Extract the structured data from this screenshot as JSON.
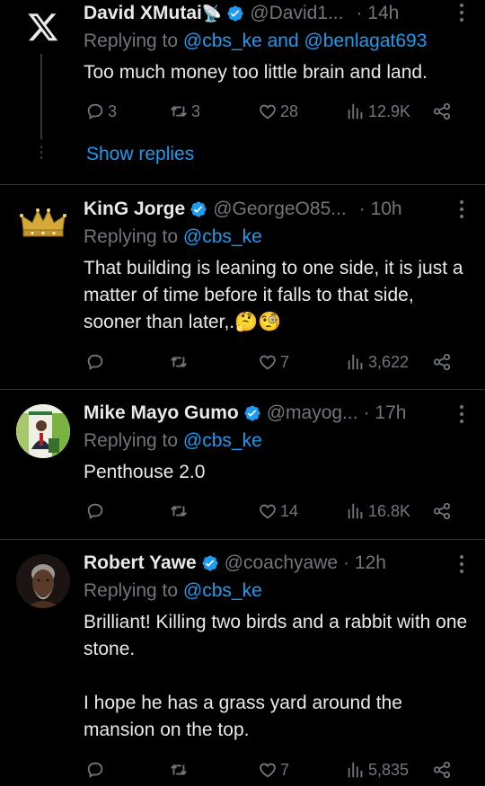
{
  "colors": {
    "background": "#000000",
    "text": "#e7e9ea",
    "muted": "#71767b",
    "accent": "#1d9bf0",
    "verified": "#1d9bf0"
  },
  "tweets": [
    {
      "name": "David XMutai",
      "name_emoji": "📡",
      "handle": "@David1...",
      "time": "· 14h",
      "replying_prefix": "Replying to ",
      "mentions": "@cbs_ke and @benlagat693",
      "text": "Too much money too little brain and land.",
      "replies": "3",
      "retweets": "3",
      "likes": "28",
      "views": "12.9K",
      "avatar_icon": "x-logo-icon"
    },
    {
      "name": "KinG Jorge",
      "handle": "@GeorgeO85...",
      "time": "· 10h",
      "replying_prefix": "Replying to ",
      "mentions": "@cbs_ke",
      "text": "That building is leaning to one side, it is just a matter of time before it falls to that side, sooner than later,.",
      "text_emoji": "🤔🧐",
      "replies": "",
      "retweets": "",
      "likes": "7",
      "views": "3,622",
      "avatar_icon": "crown-icon"
    },
    {
      "name": "Mike Mayo Gumo",
      "handle": "@mayog...",
      "time": "· 17h",
      "replying_prefix": "Replying to ",
      "mentions": "@cbs_ke",
      "text": "Penthouse 2.0",
      "replies": "",
      "retweets": "",
      "likes": "14",
      "views": "16.8K",
      "avatar_icon": "speaker-photo"
    },
    {
      "name": "Robert Yawe",
      "handle": "@coachyawe",
      "time": "· 12h",
      "replying_prefix": "Replying to ",
      "mentions": "@cbs_ke",
      "text_p1": "Brilliant! Killing two birds and a rabbit with one stone.",
      "text_p2": "I hope he has a grass yard around the mansion on the top.",
      "replies": "",
      "retweets": "",
      "likes": "7",
      "views": "5,835",
      "avatar_icon": "elder-portrait"
    }
  ],
  "show_replies": "Show replies"
}
